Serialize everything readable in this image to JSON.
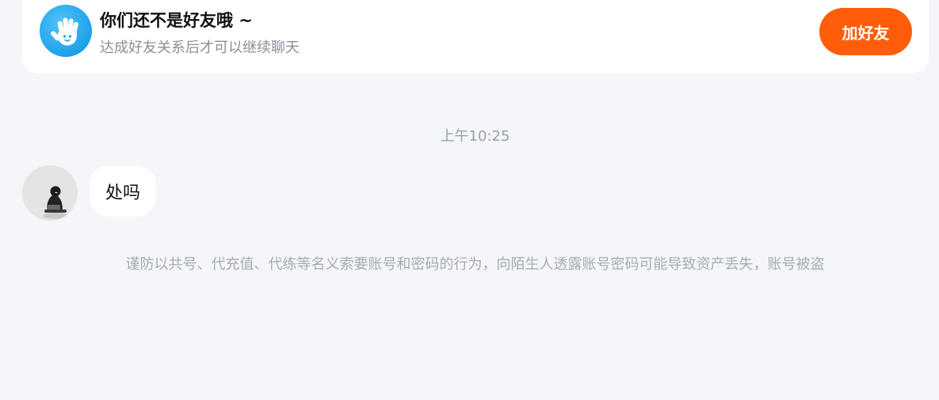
{
  "friend_notice": {
    "title": "你们还不是好友哦 ~",
    "subtitle": "达成好友关系后才可以继续聊天",
    "add_friend_label": "加好友",
    "icon": "waving-hand-icon"
  },
  "chat": {
    "timestamp": "上午10:25",
    "messages": [
      {
        "sender": "other",
        "text": "处吗"
      }
    ]
  },
  "safety_notice": "谨防以共号、代充值、代练等名义索要账号和密码的行为，向陌生人透露账号密码可能导致资产丢失，账号被盗",
  "colors": {
    "background": "#f4f6f9",
    "accent": "#ff5d0a",
    "icon_blue": "#1ea1ea"
  }
}
